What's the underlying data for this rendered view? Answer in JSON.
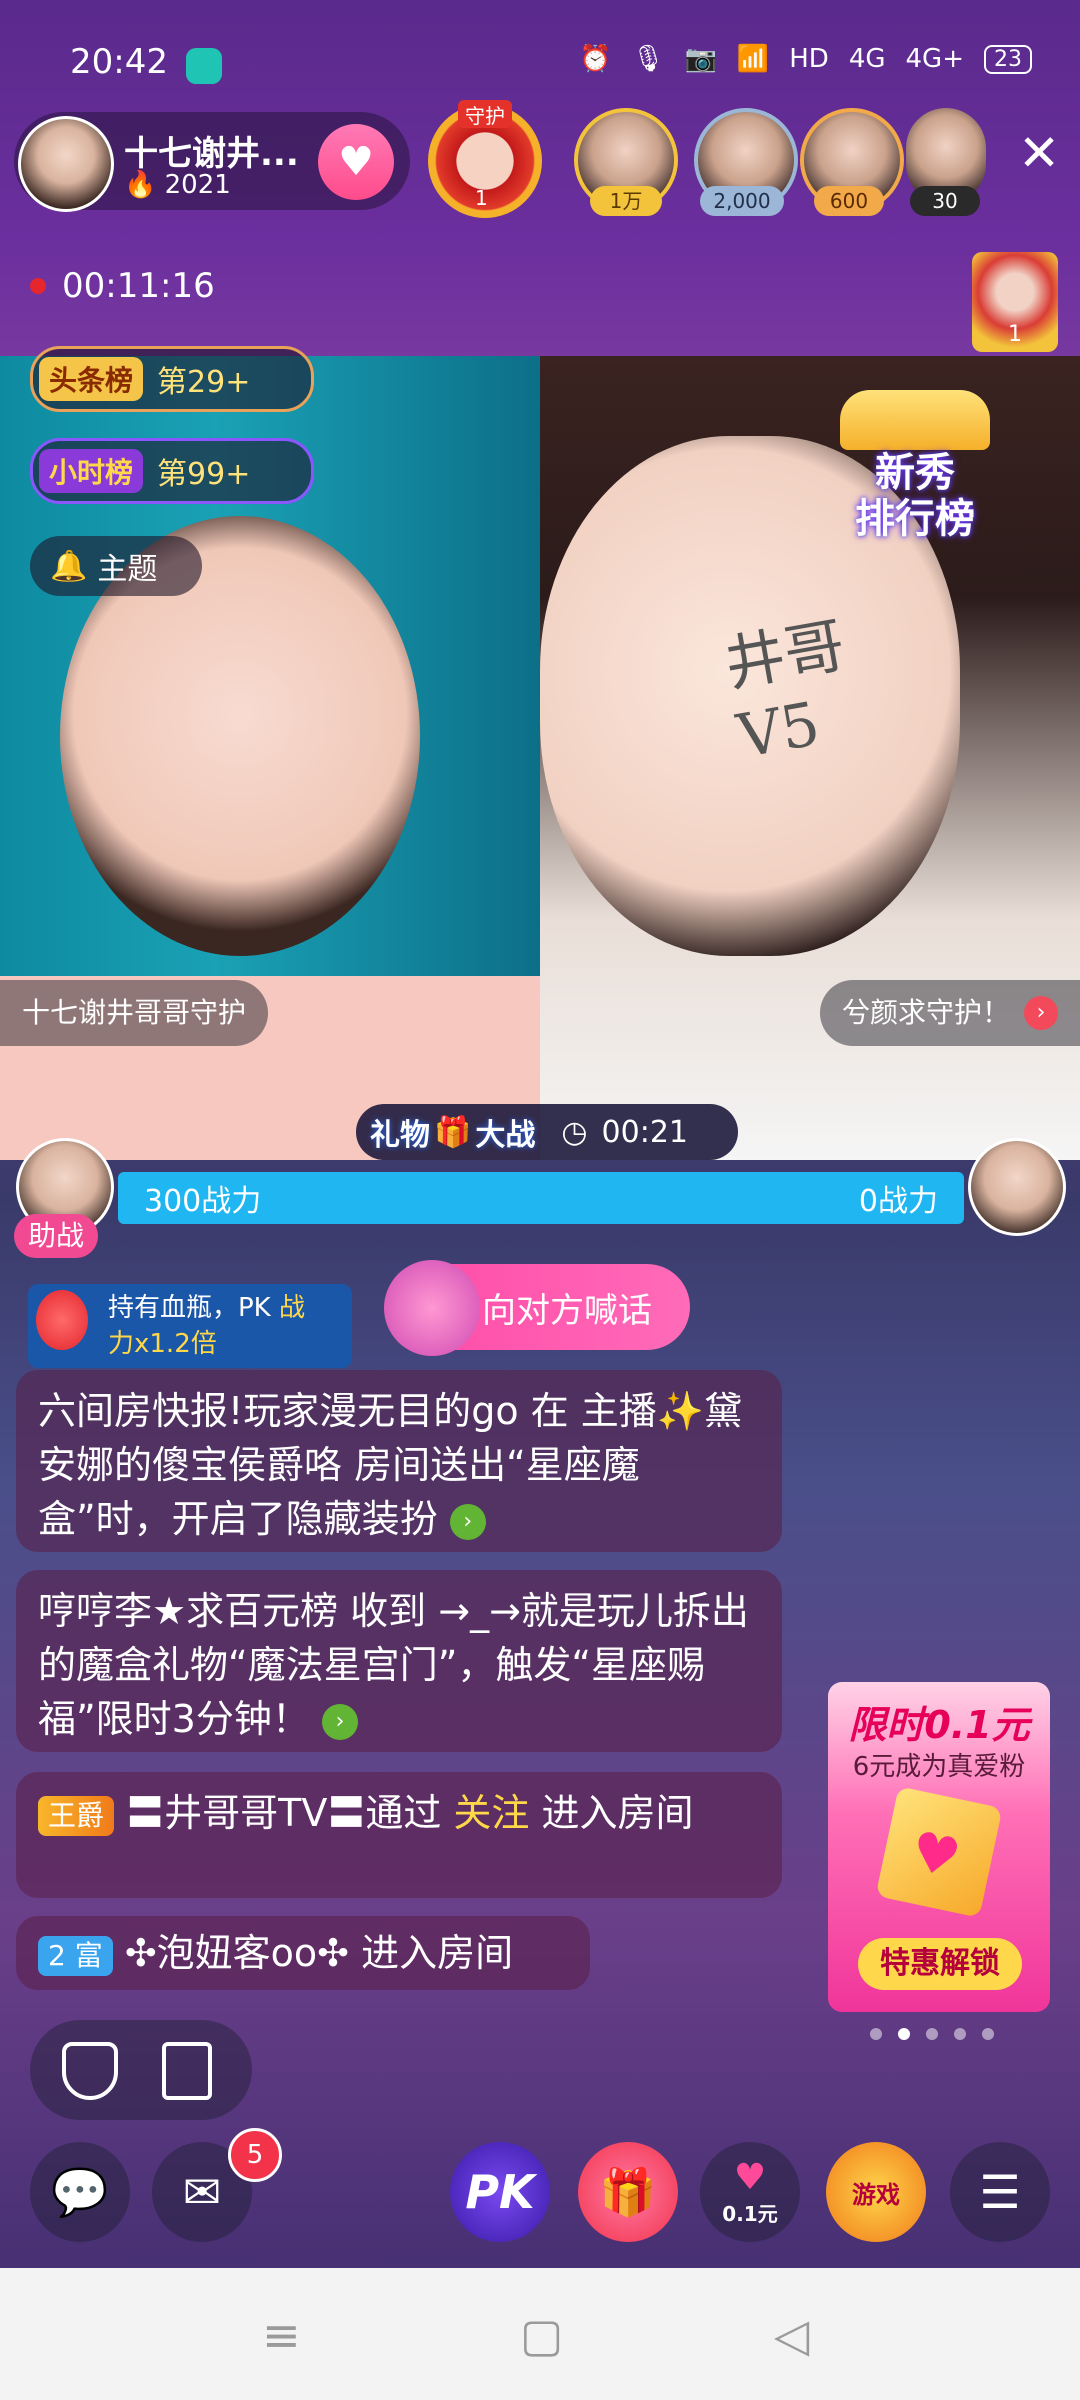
{
  "status_bar": {
    "time": "20:42",
    "network": "HD",
    "signal_a": "4G",
    "signal_b": "4G+",
    "battery": "23"
  },
  "host": {
    "name": "十七谢井...",
    "fans": "2021"
  },
  "guard": {
    "label": "守护",
    "count": "1"
  },
  "viewers": [
    {
      "badge": "1万",
      "badge_color": "#f3c43b"
    },
    {
      "badge": "2,000",
      "badge_color": "#9bb6d6"
    },
    {
      "badge": "600",
      "badge_color": "#f2a94a"
    },
    {
      "badge": "30",
      "badge_color": "#2a2a2a"
    }
  ],
  "recording": {
    "elapsed": "00:11:16"
  },
  "top_gift_count": "1",
  "ranks": [
    {
      "tag": "头条榜",
      "value": "第29+"
    },
    {
      "tag": "小时榜",
      "value": "第99+"
    }
  ],
  "theme_label": "主题",
  "xinxiu": {
    "line1": "新秀",
    "line2": "排行榜"
  },
  "caption_left": "十七谢井哥哥守护",
  "caption_right": "兮颜求守护！",
  "gift_war": {
    "label": "礼物",
    "label2": "大战",
    "time": "00:21"
  },
  "pk": {
    "left": "300战力",
    "right": "0战力"
  },
  "assist_label": "助战",
  "blood_tip": {
    "line1": "持有血瓶，PK ",
    "highlight": "战",
    "line2": "力x1.2倍"
  },
  "shout_label": "向对方喊话",
  "chat": [
    {
      "text": "六间房快报!玩家漫无目的go 在 主播✨黛安娜的傻宝侯爵咯 房间送出“星座魔盒”时，开启了隐藏装扮"
    },
    {
      "text": "哼哼李★求百元榜 收到 →_→就是玩儿拆出的魔盒礼物“魔法星宫门”，触发“星座赐福”限时3分钟！"
    },
    {
      "badge": "王爵",
      "before": "〓井哥哥TV〓通过 ",
      "highlight": "关注",
      "after": " 进入房间"
    },
    {
      "level": "2 富",
      "text": "✣泡妞客oo✣ 进入房间"
    }
  ],
  "promo": {
    "title": "限时0.1元",
    "subtitle": "6元成为真爱粉",
    "button": "特惠解锁"
  },
  "bottom": {
    "mail_count": "5",
    "pk_label": "PK",
    "price_tag": "0.1元",
    "game_label": "游戏"
  },
  "colors": {
    "accent_pink": "#ff4b8b",
    "pk_blue": "#1fb6f1",
    "highlight_yellow": "#ffd84a"
  }
}
